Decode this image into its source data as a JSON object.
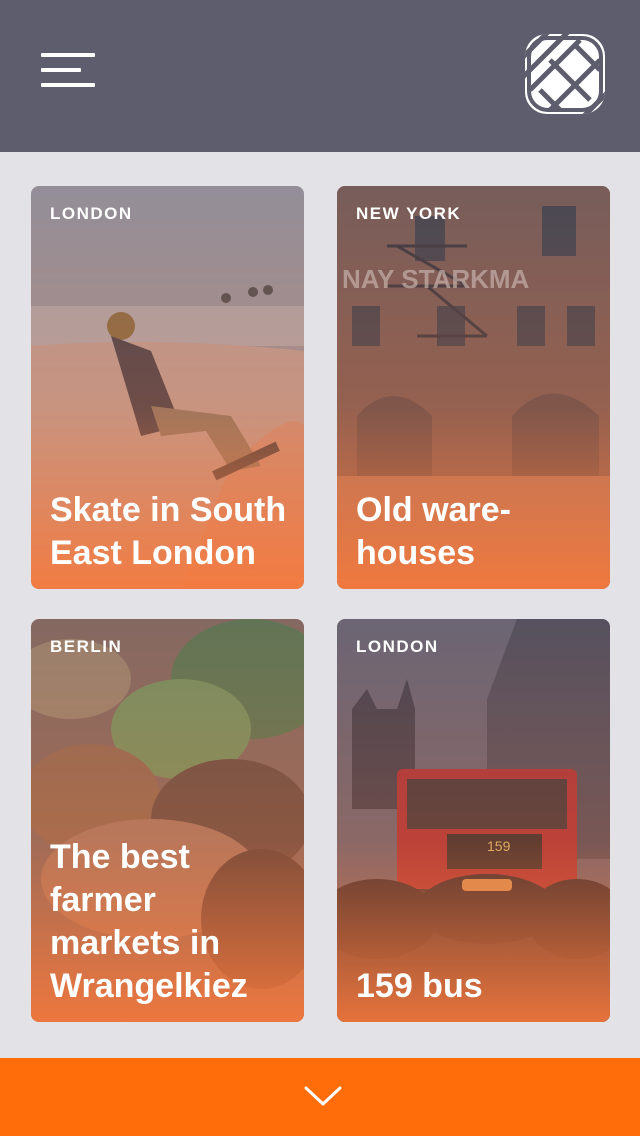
{
  "header": {
    "menu_icon": "hamburger-menu-icon",
    "logo_icon": "woven-logo-icon"
  },
  "cards": [
    {
      "city": "LONDON",
      "title": "Skate in South East London"
    },
    {
      "city": "NEW YORK",
      "title": "Old ware-houses"
    },
    {
      "city": "BERLIN",
      "title": "The best farmer markets in Wrangelkiez"
    },
    {
      "city": "LONDON",
      "title": "159 bus"
    }
  ],
  "footer": {
    "icon": "chevron-down-icon",
    "accent": "#ff6d0a"
  },
  "colors": {
    "header_bg": "#5e5d6e",
    "page_bg": "#e3e2e6",
    "accent": "#ff6d0a"
  }
}
